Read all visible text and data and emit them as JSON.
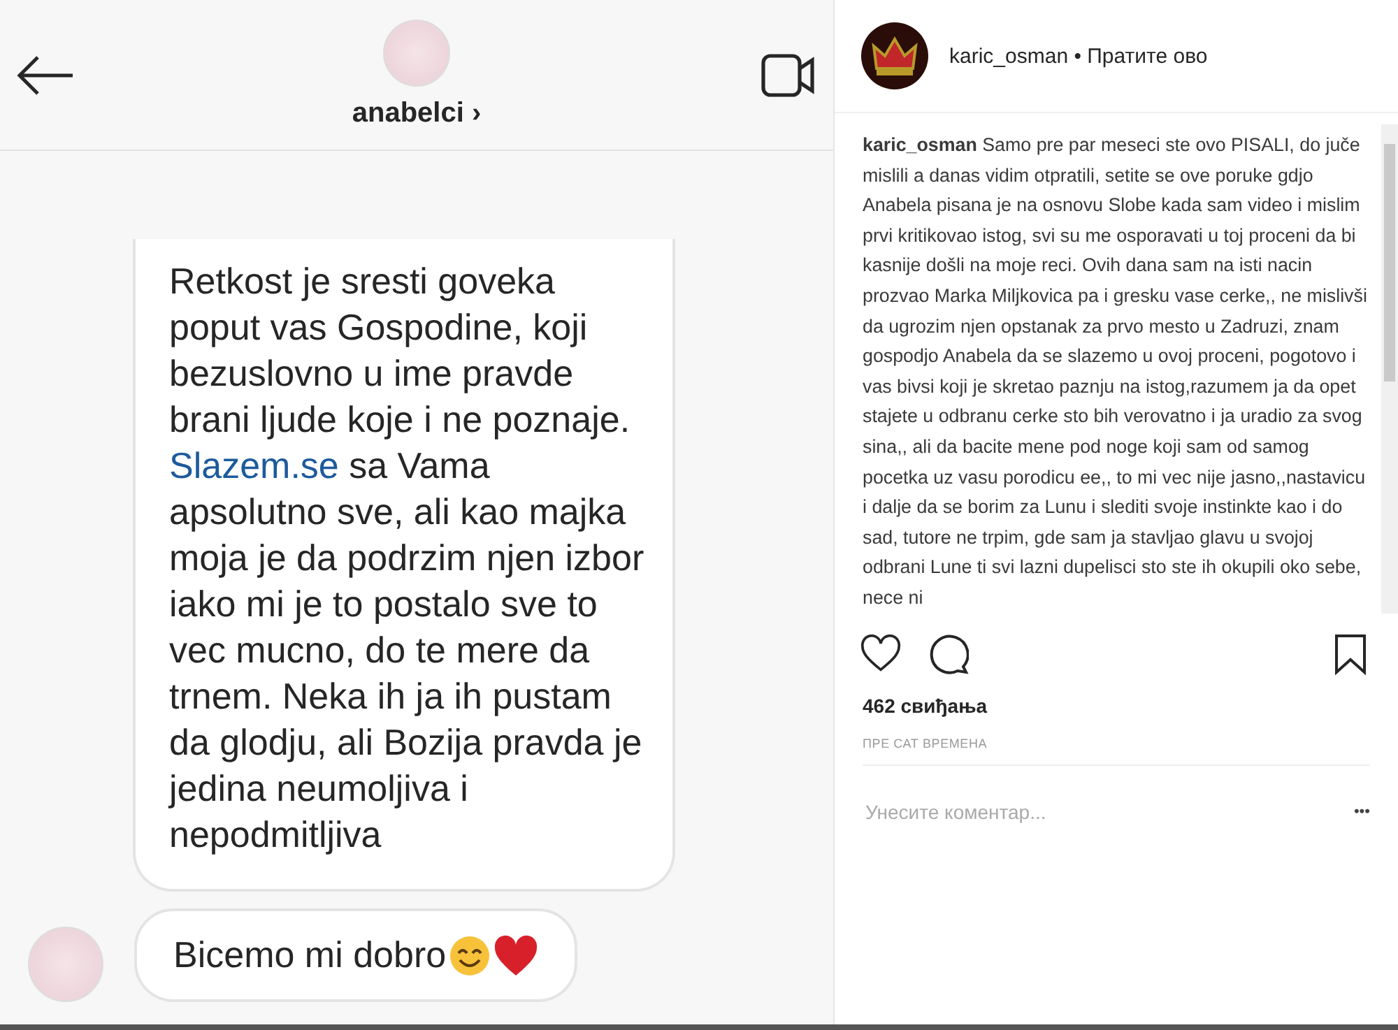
{
  "chat": {
    "username": "anabelci",
    "chevron": "›",
    "messages": [
      {
        "kind": "long",
        "before": "Retkost je sresti goveka poput vas Gospodine, koji bezuslovno u ime pravde brani ljude koje i ne poznaje.",
        "link": "Slazem.se",
        "after": "sa Vama apsolutno sve, ali kao majka moja je da podrzim njen izbor iako mi je to postalo sve to vec mucno, do te mere da trnem. Neka ih ja ih pustam da glodju, ali Bozija pravda je jedina neumoljiva i nepodmitljiva"
      },
      {
        "kind": "short",
        "text": "Bicemo mi dobro"
      }
    ]
  },
  "post": {
    "username": "karic_osman",
    "follow": "• Пратите ово",
    "caption_user": "karic_osman",
    "caption": "Samo pre par meseci ste ovo PISALI, do juče mislili a danas vidim otpratili, setite se ove poruke gdjo Anabela pisana je na osnovu Slobe kada sam video i mislim prvi kritikovao istog, svi su me osporavati u toj proceni da bi kasnije došli na moje reci. Ovih dana sam na isti nacin prozvao Marka Miljkovica pa i gresku vase cerke,, ne mislivši da ugrozim njen opstanak za prvo mesto u Zadruzi, znam gospodjo Anabela da se slazemo u ovoj proceni, pogotovo i vas bivsi koji je skretao paznju na istog,razumem ja da opet stajete u odbranu cerke sto bih verovatno i ja uradio za svog sina,, ali da bacite mene pod noge koji sam od samog pocetka uz vasu porodicu ee,, to mi vec nije jasno,,nastavicu i dalje da se borim za Lunu i slediti svoje instinkte kao i do sad, tutore ne trpim, gde sam ja stavljao glavu u svojoj odbrani Lune ti svi lazni dupelisci sto ste ih okupili oko sebe, nece ni",
    "likes": "462 свиђања",
    "time": "ПРЕ САТ ВРЕМЕНА",
    "comment": {
      "placeholder": "Унесите коментар..."
    },
    "more": "•••"
  }
}
